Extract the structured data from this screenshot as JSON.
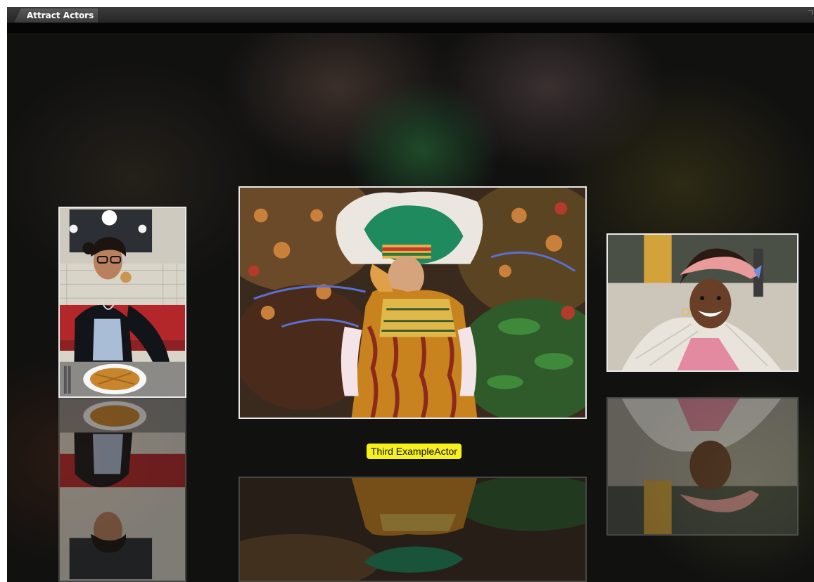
{
  "window": {
    "tab_title": "Attract Actors"
  },
  "stage": {
    "background_image": "blurred-festival-dancer",
    "actors": [
      {
        "id": "first",
        "image": "woman-eating-waffle",
        "selected": false
      },
      {
        "id": "third",
        "image": "festival-dancer-feathered-headdress",
        "selected": true,
        "label": "Third ExampleActor"
      },
      {
        "id": "second",
        "image": "smiling-woman-headscarf",
        "selected": false
      }
    ]
  },
  "colors": {
    "label_background": "#f6f01e",
    "tab_background": "#3a3a3a",
    "actor_border": "#e8e8e8"
  }
}
